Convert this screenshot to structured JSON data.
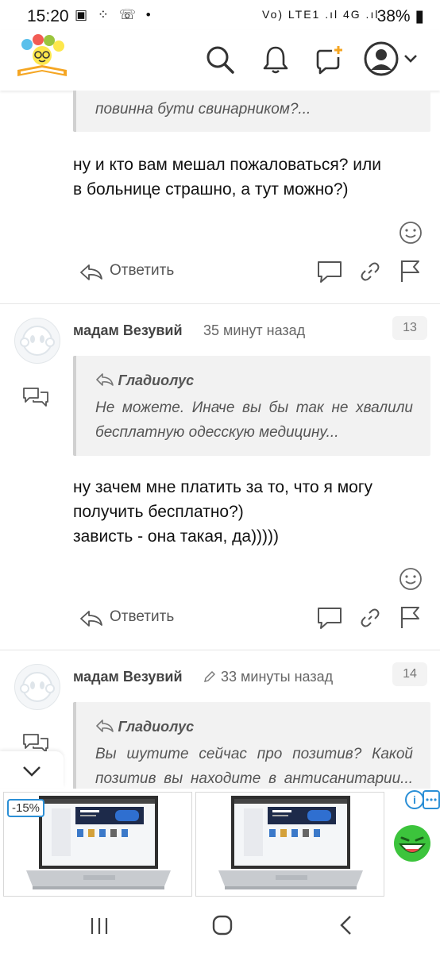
{
  "status_bar": {
    "time": "15:20",
    "left_icons": "▣ ⁘ ☏ •",
    "network": "Vo) LTE1 .ıl 4G .ıl",
    "battery": "38%"
  },
  "comments": [
    {
      "quote": {
        "text": "повинна бути свинарником?..."
      },
      "text_lines": [
        "ну и кто вам мешал пожаловаться? или",
        "в больнице страшно, а тут можно?)"
      ],
      "reply_label": "Ответить"
    },
    {
      "author": "мадам Везувий",
      "time": "35 минут назад",
      "number": "13",
      "quote": {
        "author": "Гладиолус",
        "lines": [
          "Не можете. Иначе вы бы так не хвалили",
          "бесплатную одесскую медицину..."
        ]
      },
      "text_lines": [
        "ну зачем мне платить за то, что я могу",
        "получить бесплатно?)",
        "зависть - она такая, да)))))"
      ],
      "reply_label": "Ответить"
    },
    {
      "author": "мадам Везувий",
      "time": "33 минуты назад",
      "number": "14",
      "quote": {
        "author": "Гладиолус",
        "lines": [
          "Вы шутите сейчас про позитив? Какой",
          "позитив вы находите в антисанитарии..."
        ]
      }
    }
  ],
  "ad": {
    "discount": "-15%",
    "info": "i"
  },
  "colors": {
    "accent": "#f5a623",
    "ad_border": "#2b8fd6"
  }
}
